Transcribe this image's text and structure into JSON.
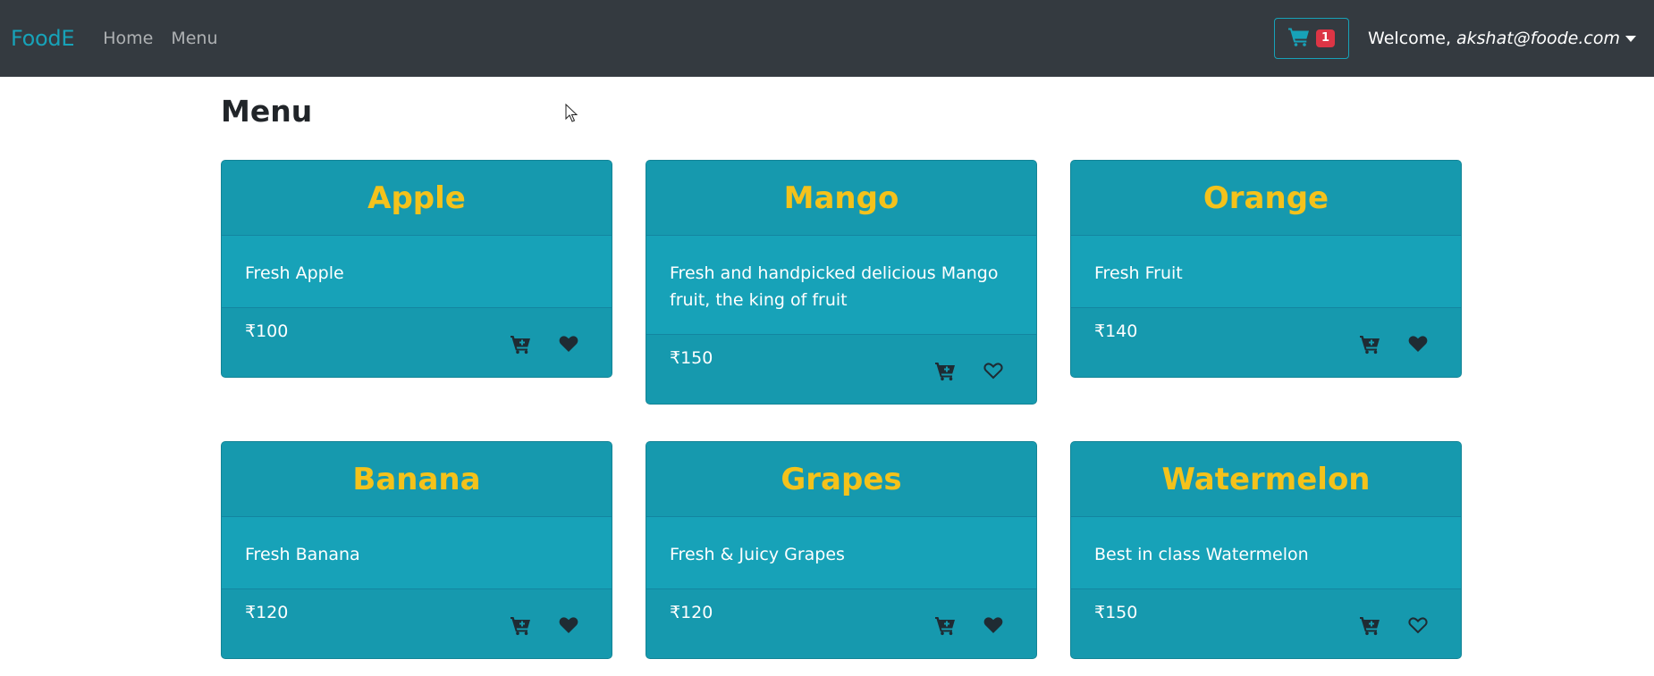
{
  "nav": {
    "brand": "FoodE",
    "links": [
      "Home",
      "Menu"
    ],
    "cart_count": "1",
    "welcome_label": "Welcome,",
    "user_email": "akshat@foode.com"
  },
  "page": {
    "title": "Menu"
  },
  "products": [
    {
      "name": "Apple",
      "description": "Fresh Apple",
      "price": "₹100",
      "favorite": true
    },
    {
      "name": "Mango",
      "description": "Fresh and handpicked delicious Mango fruit, the king of fruit",
      "price": "₹150",
      "favorite": false
    },
    {
      "name": "Orange",
      "description": "Fresh Fruit",
      "price": "₹140",
      "favorite": true
    },
    {
      "name": "Banana",
      "description": "Fresh Banana",
      "price": "₹120",
      "favorite": true
    },
    {
      "name": "Grapes",
      "description": "Fresh & Juicy Grapes",
      "price": "₹120",
      "favorite": true
    },
    {
      "name": "Watermelon",
      "description": "Best in class Watermelon",
      "price": "₹150",
      "favorite": false
    }
  ],
  "colors": {
    "navbar_bg": "#343a40",
    "brand": "#17a2b8",
    "card_bg": "#17a2b8",
    "card_title": "#f4c21b",
    "badge": "#dc3545"
  }
}
